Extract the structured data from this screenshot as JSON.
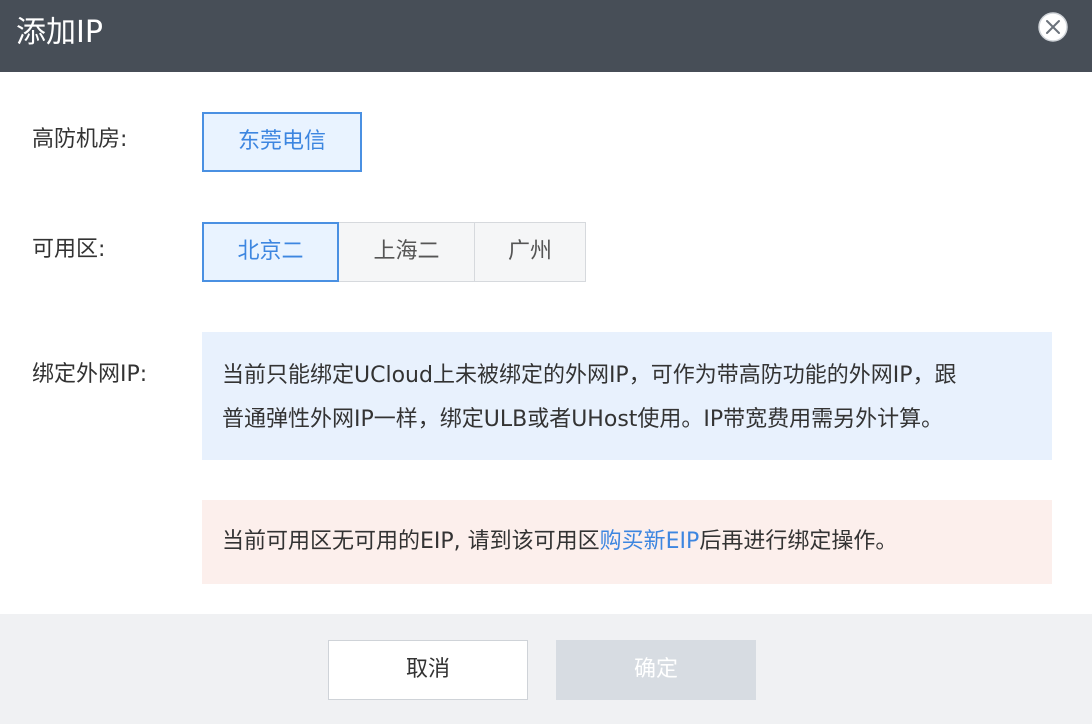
{
  "dialog": {
    "title": "添加IP",
    "close_icon": "close-circle-icon"
  },
  "form": {
    "datacenter": {
      "label": "高防机房:",
      "options": [
        "东莞电信"
      ],
      "selected": "东莞电信"
    },
    "zone": {
      "label": "可用区:",
      "options": [
        "北京二",
        "上海二",
        "广州"
      ],
      "selected": "北京二"
    },
    "bind_ip": {
      "label": "绑定外网IP:",
      "info_line1": "当前只能绑定UCloud上未被绑定的外网IP，可作为带高防功能的外网IP，跟",
      "info_line2": "普通弹性外网IP一样，绑定ULB或者UHost使用。IP带宽费用需另外计算。",
      "warn_prefix": "当前可用区无可用的EIP, 请到该可用区",
      "warn_link": "购买新EIP",
      "warn_suffix": "后再进行绑定操作。"
    }
  },
  "footer": {
    "cancel_label": "取消",
    "confirm_label": "确定"
  },
  "colors": {
    "header_bg": "#474e57",
    "accent": "#4a90e2",
    "info_bg": "#e8f1fd",
    "warn_bg": "#fcefec",
    "footer_bg": "#f0f1f3",
    "confirm_disabled_bg": "#d7dce2"
  }
}
